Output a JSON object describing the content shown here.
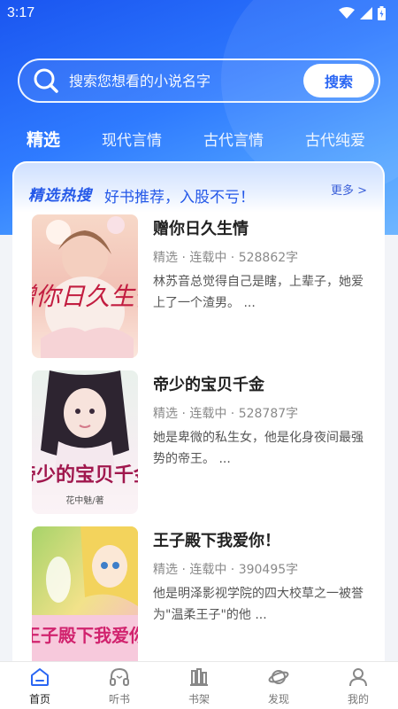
{
  "status_bar": {
    "time": "3:17"
  },
  "search": {
    "placeholder": "搜索您想看的小说名字",
    "button_label": "搜索"
  },
  "tabs": [
    {
      "label": "精选",
      "active": true
    },
    {
      "label": "现代言情",
      "active": false
    },
    {
      "label": "古代言情",
      "active": false
    },
    {
      "label": "古代纯爱",
      "active": false
    }
  ],
  "section": {
    "title": "精选热搜",
    "slogan": "好书推荐，入股不亏！",
    "more_label": "更多 >"
  },
  "books": [
    {
      "title": "赠你日久生情",
      "meta": "精选 · 连载中 · 528862字",
      "description": "林苏音总觉得自己是瞎，上辈子，她爱上了一个渣男。 ...",
      "cover_text": "赠你日久生情"
    },
    {
      "title": "帝少的宝贝千金",
      "meta": "精选 · 连载中 · 528787字",
      "description": "她是卑微的私生女，他是化身夜间最强势的帝王。 ...",
      "cover_text": "帝少的宝贝千金",
      "cover_author": "花中魅/著"
    },
    {
      "title": "王子殿下我爱你！",
      "meta": "精选 · 连载中 · 390495字",
      "description": "他是明泽影视学院的四大校草之一被誉为\"温柔王子\"的他 ...",
      "cover_text": "王子殿下我爱你"
    }
  ],
  "bottom_nav": [
    {
      "label": "首页",
      "icon": "home-icon",
      "active": true
    },
    {
      "label": "听书",
      "icon": "headphones-icon",
      "active": false
    },
    {
      "label": "书架",
      "icon": "bookshelf-icon",
      "active": false
    },
    {
      "label": "发现",
      "icon": "planet-icon",
      "active": false
    },
    {
      "label": "我的",
      "icon": "user-icon",
      "active": false
    }
  ],
  "colors": {
    "accent": "#2a66f3",
    "header_blue": "#1a55f0"
  }
}
